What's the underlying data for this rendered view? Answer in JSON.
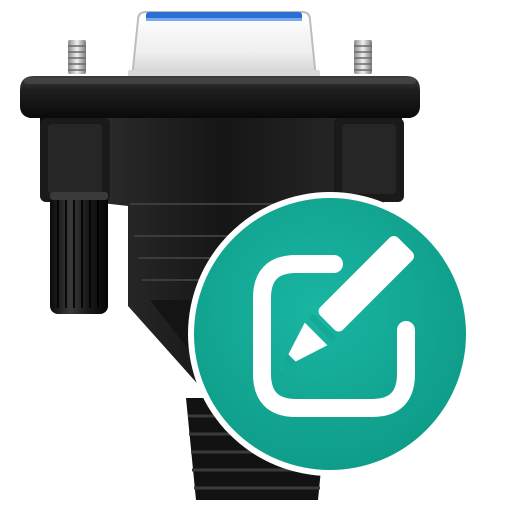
{
  "icon": {
    "name": "serial-port-edit-app-icon",
    "parts": [
      "db9-serial-connector-icon",
      "edit-badge-icon",
      "pencil-icon"
    ]
  },
  "colors": {
    "connector_body": "#141414",
    "connector_highlight": "#3a3a3a",
    "socket_shell": "#f2f2f2",
    "socket_accent": "#2b6fd6",
    "screw_metal": "#c9c9c9",
    "badge_teal": "#14a896",
    "badge_symbol": "#ffffff"
  }
}
